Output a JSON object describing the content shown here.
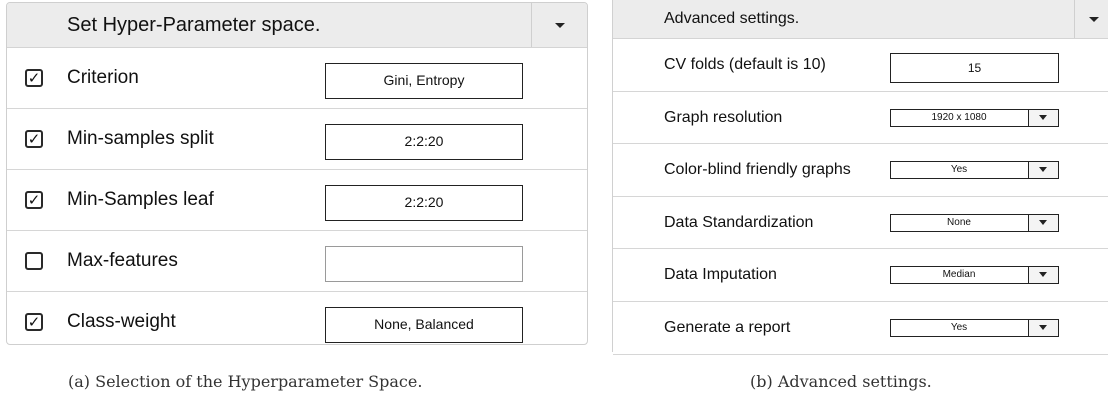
{
  "hyperparameter_panel": {
    "title": "Set Hyper-Parameter space.",
    "rows": [
      {
        "label": "Criterion",
        "checked": true,
        "value": "Gini, Entropy"
      },
      {
        "label": "Min-samples split",
        "checked": true,
        "value": "2:2:20"
      },
      {
        "label": "Min-Samples leaf",
        "checked": true,
        "value": "2:2:20"
      },
      {
        "label": "Max-features",
        "checked": false,
        "value": ""
      },
      {
        "label": "Class-weight",
        "checked": true,
        "value": "None, Balanced"
      }
    ]
  },
  "advanced_panel": {
    "title": "Advanced settings.",
    "rows": [
      {
        "label": "CV folds (default is 10)",
        "value": "15",
        "kind": "text"
      },
      {
        "label": "Graph resolution",
        "value": "1920 x 1080",
        "kind": "select"
      },
      {
        "label": "Color-blind friendly graphs",
        "value": "Yes",
        "kind": "select"
      },
      {
        "label": "Data Standardization",
        "value": "None",
        "kind": "select"
      },
      {
        "label": "Data Imputation",
        "value": "Median",
        "kind": "select"
      },
      {
        "label": "Generate a report",
        "value": "Yes",
        "kind": "select"
      }
    ]
  },
  "captions": {
    "a": "(a) Selection of the Hyperparameter Space.",
    "b": "(b) Advanced settings."
  },
  "icons": {
    "checkbox_checked": "check-mark-icon",
    "dropdown": "chevron-down-icon"
  }
}
